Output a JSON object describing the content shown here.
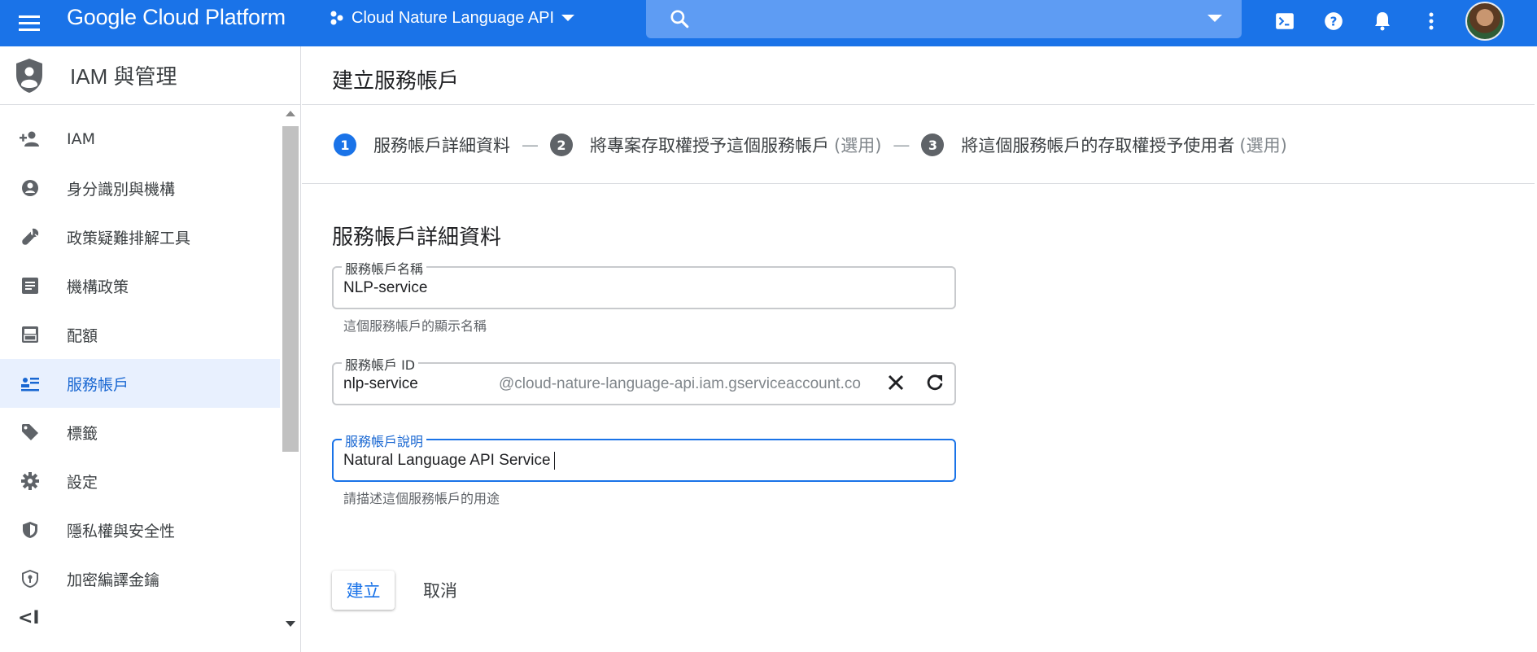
{
  "topbar": {
    "brand": "Google Cloud Platform",
    "project_name": "Cloud Nature Language API",
    "search_placeholder": ""
  },
  "sidebar": {
    "title": "IAM 與管理",
    "items": [
      {
        "label": "IAM",
        "icon": "person-add-icon"
      },
      {
        "label": "身分識別與機構",
        "icon": "account-circle-icon"
      },
      {
        "label": "政策疑難排解工具",
        "icon": "wrench-icon"
      },
      {
        "label": "機構政策",
        "icon": "list-icon"
      },
      {
        "label": "配額",
        "icon": "quota-icon"
      },
      {
        "label": "服務帳戶",
        "icon": "service-account-icon",
        "active": true
      },
      {
        "label": "標籤",
        "icon": "tag-icon"
      },
      {
        "label": "設定",
        "icon": "gear-icon"
      },
      {
        "label": "隱私權與安全性",
        "icon": "shield-icon"
      },
      {
        "label": "加密編譯金鑰",
        "icon": "key-shield-icon"
      }
    ],
    "collapse_label": "<I"
  },
  "main": {
    "page_title": "建立服務帳戶",
    "steps": [
      {
        "num": "1",
        "label": "服務帳戶詳細資料",
        "optional": ""
      },
      {
        "num": "2",
        "label": "將專案存取權授予這個服務帳戶",
        "optional": "(選用)"
      },
      {
        "num": "3",
        "label": "將這個服務帳戶的存取權授予使用者",
        "optional": "(選用)"
      }
    ],
    "step_sep": "—",
    "section_title": "服務帳戶詳細資料",
    "fields": {
      "name": {
        "label": "服務帳戶名稱",
        "value": "NLP-service",
        "hint": "這個服務帳戶的顯示名稱"
      },
      "id": {
        "label": "服務帳戶 ID",
        "value": "nlp-service",
        "suffix": "@cloud-nature-language-api.iam.gserviceaccount.co"
      },
      "description": {
        "label": "服務帳戶說明",
        "value": "Natural Language API Service",
        "hint": "請描述這個服務帳戶的用途"
      }
    },
    "create_label": "建立",
    "cancel_label": "取消"
  },
  "colors": {
    "brand_blue": "#1a73e8",
    "search_bg": "#5e9cf3",
    "active_nav_bg": "#e8f0fe"
  }
}
